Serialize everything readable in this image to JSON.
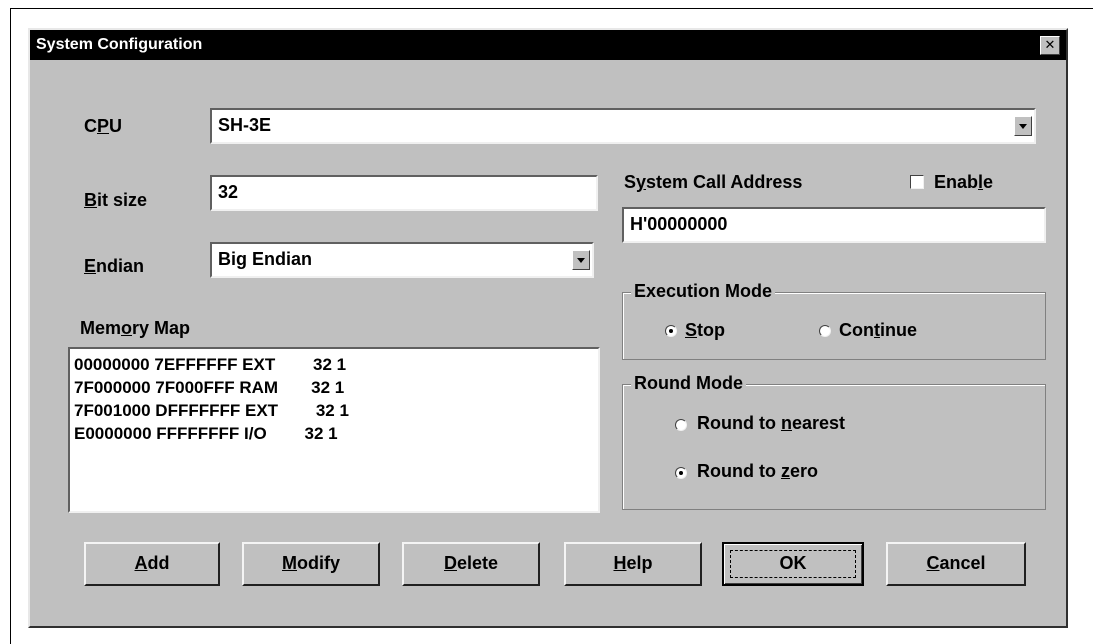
{
  "window": {
    "title": "System Configuration",
    "close_icon": "close-icon"
  },
  "cpu": {
    "label_pre": "C",
    "label_u": "P",
    "label_post": "U",
    "value": "SH-3E"
  },
  "bit_size": {
    "label_u": "B",
    "label_post": "it size",
    "value": "32"
  },
  "endian": {
    "label_u": "E",
    "label_post": "ndian",
    "value": "Big Endian"
  },
  "system_call": {
    "label_pre": "S",
    "label_u": "y",
    "label_post": "stem Call Address",
    "value": "H'00000000",
    "enable_pre": "Enab",
    "enable_u": "l",
    "enable_post": "e",
    "enabled": false
  },
  "memory_map": {
    "label_pre": "Mem",
    "label_u": "o",
    "label_post": "ry Map",
    "rows": [
      "00000000 7EFFFFFF EXT        32 1",
      "7F000000 7F000FFF RAM       32 1",
      "7F001000 DFFFFFFF EXT        32 1",
      "E0000000 FFFFFFFF I/O        32 1"
    ]
  },
  "execution_mode": {
    "title": "Execution Mode",
    "stop": {
      "pre": "",
      "u": "S",
      "post": "top",
      "selected": true
    },
    "continue": {
      "pre": "Con",
      "u": "t",
      "post": "inue",
      "selected": false
    }
  },
  "round_mode": {
    "title": "Round Mode",
    "nearest": {
      "pre": "Round to ",
      "u": "n",
      "post": "earest",
      "selected": false
    },
    "zero": {
      "pre": "Round to ",
      "u": "z",
      "post": "ero",
      "selected": true
    }
  },
  "buttons": {
    "add": {
      "u": "A",
      "post": "dd"
    },
    "modify": {
      "u": "M",
      "post": "odify"
    },
    "delete": {
      "u": "D",
      "post": "elete"
    },
    "help": {
      "u": "H",
      "post": "elp"
    },
    "ok": {
      "label": "OK"
    },
    "cancel": {
      "u": "C",
      "post": "ancel"
    }
  }
}
